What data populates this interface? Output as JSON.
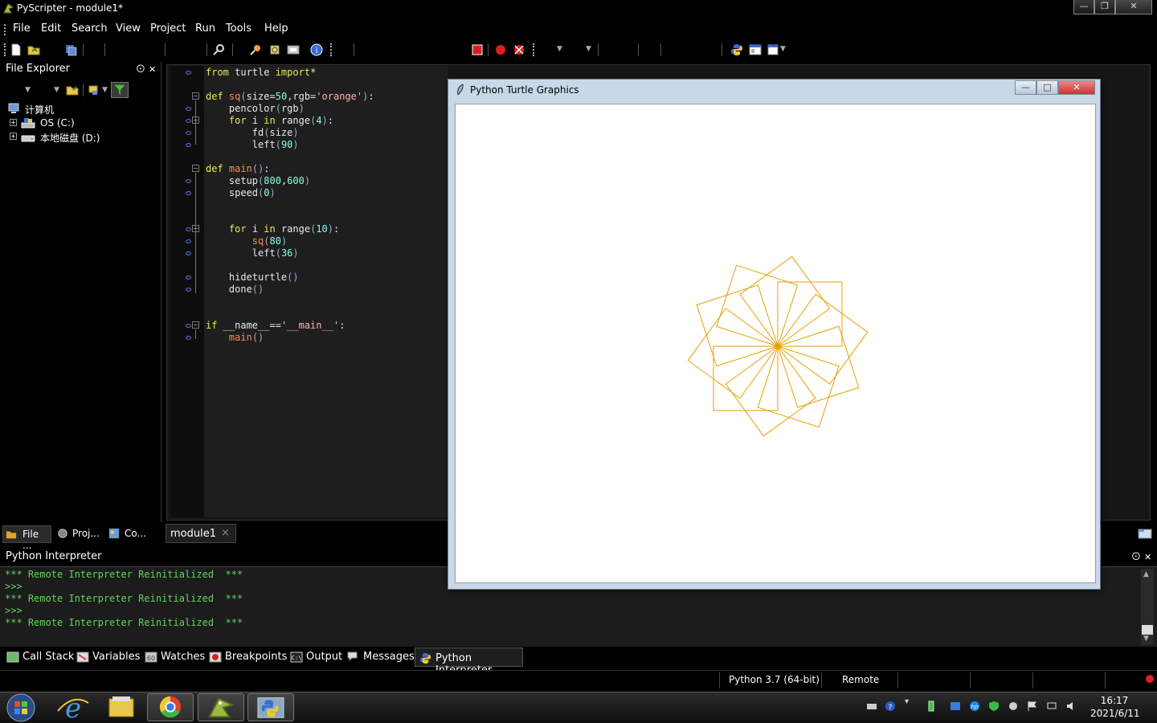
{
  "window": {
    "title": "PyScripter - module1*"
  },
  "menu": [
    "File",
    "Edit",
    "Search",
    "View",
    "Project",
    "Run",
    "Tools",
    "Help"
  ],
  "file_explorer": {
    "title": "File Explorer",
    "pin": "ᴘ",
    "close": "✕",
    "tree": [
      {
        "label": "计算机",
        "icon": "computer-icon"
      },
      {
        "label": "OS (C:)",
        "icon": "drive-c-icon"
      },
      {
        "label": "本地磁盘 (D:)",
        "icon": "drive-d-icon"
      }
    ],
    "bottom_tabs": [
      "File ...",
      "Proj...",
      "Co..."
    ]
  },
  "editor": {
    "tab": "module1",
    "tab_close": "×",
    "lines": [
      {
        "t": "from turtle import*"
      },
      {
        "t": ""
      },
      {
        "t": "def sq(size=50,rgb='orange'):"
      },
      {
        "t": "    pencolor(rgb)"
      },
      {
        "t": "    for i in range(4):"
      },
      {
        "t": "        fd(size)"
      },
      {
        "t": "        left(90)"
      },
      {
        "t": ""
      },
      {
        "t": "def main():"
      },
      {
        "t": "    setup(800,600)"
      },
      {
        "t": "    speed(0)"
      },
      {
        "t": ""
      },
      {
        "t": ""
      },
      {
        "t": "    for i in range(10):"
      },
      {
        "t": "        sq(80)"
      },
      {
        "t": "        left(36)"
      },
      {
        "t": ""
      },
      {
        "t": "    hideturtle()"
      },
      {
        "t": "    done()"
      },
      {
        "t": ""
      },
      {
        "t": ""
      },
      {
        "t": "if __name__=='__main__':"
      },
      {
        "t": "    main()"
      }
    ]
  },
  "turtle_window": {
    "title": "Python Turtle Graphics",
    "square_count": 10,
    "square_size": 80,
    "rotation_step_deg": 36,
    "pen_color": "#e6a000"
  },
  "interpreter": {
    "title": "Python Interpreter",
    "lines": [
      "*** Remote Interpreter Reinitialized  ***",
      ">>>",
      "*** Remote Interpreter Reinitialized  ***",
      ">>>",
      "*** Remote Interpreter Reinitialized  ***"
    ]
  },
  "debug_tabs": [
    "Call Stack",
    "Variables",
    "Watches",
    "Breakpoints",
    "Output",
    "Messages",
    "Python Interpreter"
  ],
  "status": {
    "python": "Python 3.7 (64-bit)",
    "engine": "Remote"
  },
  "clock": {
    "time": "16:17",
    "date": "2021/6/11"
  }
}
